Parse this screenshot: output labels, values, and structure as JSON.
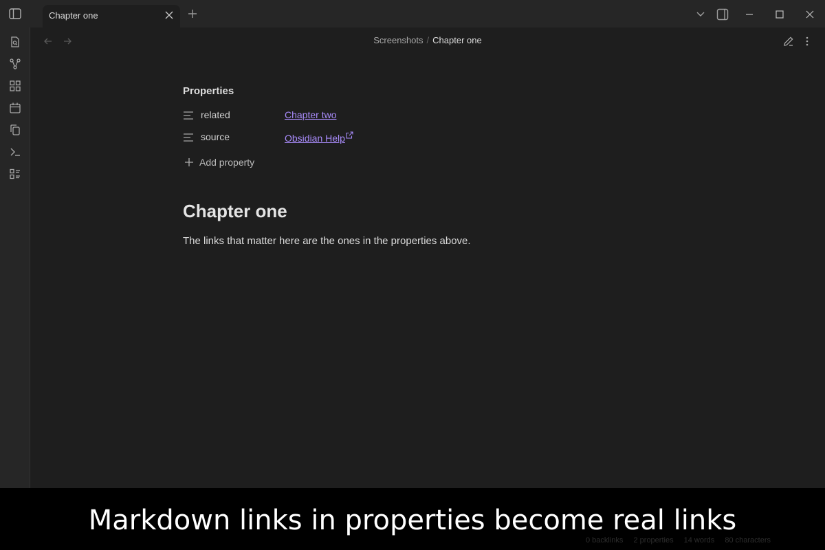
{
  "tab": {
    "title": "Chapter one"
  },
  "breadcrumb": {
    "parent": "Screenshots",
    "separator": "/",
    "current": "Chapter one"
  },
  "properties": {
    "heading": "Properties",
    "items": [
      {
        "key": "related",
        "value": "Chapter two",
        "external": false
      },
      {
        "key": "source",
        "value": "Obsidian Help",
        "external": true
      }
    ],
    "add_label": "Add property"
  },
  "note": {
    "title": "Chapter one",
    "body": "The links that matter here are the ones in the properties above."
  },
  "status": {
    "backlinks": "0 backlinks",
    "properties": "2 properties",
    "words": "14 words",
    "characters": "80 characters"
  },
  "banner": {
    "text": "Markdown links in properties become real links"
  },
  "colors": {
    "accent": "#a88bfa",
    "background": "#1e1e1e",
    "chrome": "#262626"
  }
}
